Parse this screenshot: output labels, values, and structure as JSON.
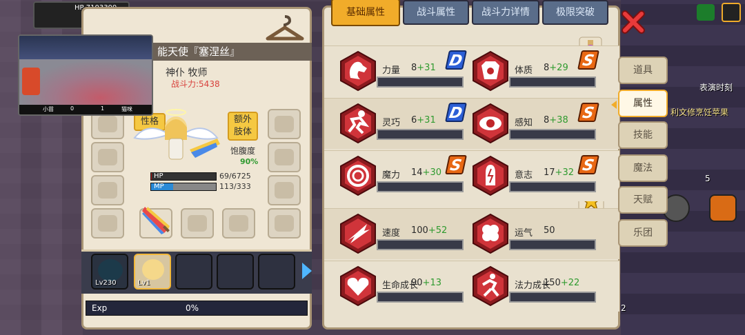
{
  "hud": {
    "top_hp_label": "HP",
    "top_hp_value": "7103300"
  },
  "video_overlay": {
    "left_name": "小苗",
    "score_left": "0",
    "score_mid": "1",
    "right_name": "猫咪"
  },
  "character": {
    "name_title": "能天使『塞涅丝』",
    "class": "神仆 牧师",
    "power_label": "战斗力:5438",
    "personality_button": "性格",
    "extra_limb_button_line1": "额外",
    "extra_limb_button_line2": "肢体",
    "hunger_label": "饱腹度",
    "hunger_value": "90%",
    "hp_label": "HP",
    "hp_value": "69/6725",
    "hp_fraction": 0.01,
    "mp_label": "MP",
    "mp_value": "113/333",
    "mp_fraction": 0.34
  },
  "party": [
    {
      "level": "Lv230",
      "active": false
    },
    {
      "level": "Lv1",
      "active": true
    },
    {
      "level": "",
      "active": false
    },
    {
      "level": "",
      "active": false
    },
    {
      "level": "",
      "active": false
    }
  ],
  "exp": {
    "label": "Exp",
    "value": "0%"
  },
  "tabs": [
    {
      "label": "基础属性",
      "active": true
    },
    {
      "label": "战斗属性",
      "active": false
    },
    {
      "label": "战斗力详情",
      "active": false
    },
    {
      "label": "极限突破",
      "active": false
    }
  ],
  "stats": [
    [
      {
        "name": "力量",
        "base": "8",
        "bonus": "+31",
        "grade": "D",
        "icon": "strength-icon"
      },
      {
        "name": "体质",
        "base": "8",
        "bonus": "+29",
        "grade": "S",
        "icon": "constitution-icon"
      }
    ],
    [
      {
        "name": "灵巧",
        "base": "6",
        "bonus": "+31",
        "grade": "D",
        "icon": "agility-icon"
      },
      {
        "name": "感知",
        "base": "8",
        "bonus": "+38",
        "grade": "S",
        "icon": "perception-icon"
      }
    ],
    [
      {
        "name": "魔力",
        "base": "14",
        "bonus": "+30",
        "grade": "S",
        "icon": "magic-icon"
      },
      {
        "name": "意志",
        "base": "17",
        "bonus": "+32",
        "grade": "S",
        "icon": "will-icon"
      }
    ],
    [
      {
        "name": "速度",
        "base": "100",
        "bonus": "+52",
        "grade": "",
        "icon": "speed-icon"
      },
      {
        "name": "运气",
        "base": "50",
        "bonus": "",
        "grade": "",
        "icon": "luck-icon"
      }
    ],
    [
      {
        "name": "生命成长",
        "base": "90",
        "bonus": "+13",
        "grade": "",
        "icon": "hp-growth-icon"
      },
      {
        "name": "法力成长",
        "base": "150",
        "bonus": "+22",
        "grade": "",
        "icon": "mp-growth-icon"
      }
    ]
  ],
  "side_nav": [
    {
      "label": "道具",
      "active": false
    },
    {
      "label": "属性",
      "active": true
    },
    {
      "label": "技能",
      "active": false
    },
    {
      "label": "魔法",
      "active": false
    },
    {
      "label": "天赋",
      "active": false
    },
    {
      "label": "乐团",
      "active": false
    }
  ],
  "background_labels": {
    "time_label": "表演时刻",
    "scroll_text": "利文修烹饪苹果",
    "count_right": "5",
    "count_bottom": "2"
  },
  "colors": {
    "accent_tab": "#f1ac2a",
    "panel_bg": "#e9e1cf",
    "grade_s": "#e86814",
    "grade_d": "#2c5fd6",
    "bonus_green": "#2e9a2e",
    "power_red": "#d8413c"
  }
}
